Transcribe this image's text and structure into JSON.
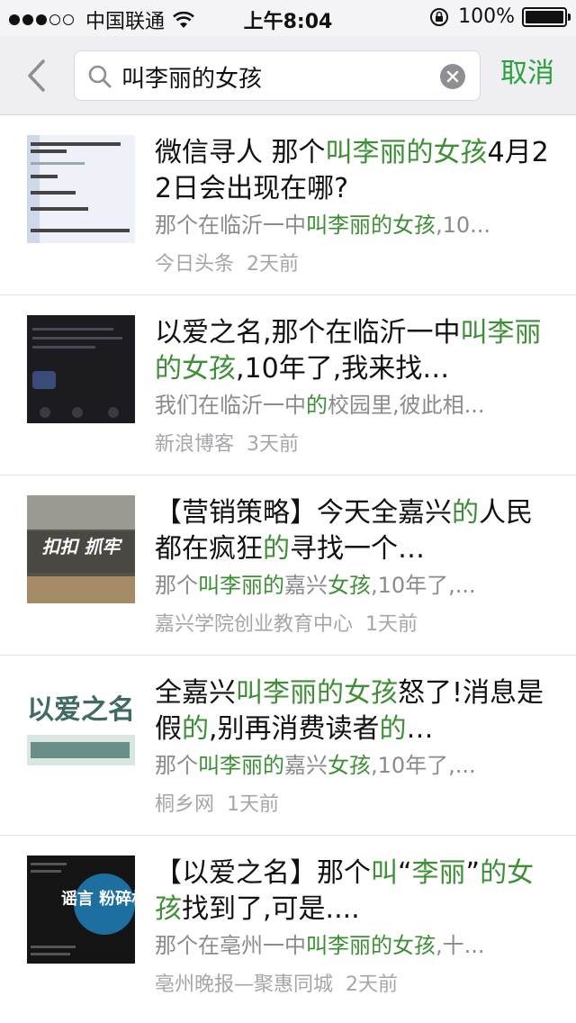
{
  "status_bar": {
    "carrier": "中国联通",
    "time": "上午8:04",
    "battery": "100%",
    "signal_full": 3,
    "signal_total": 5
  },
  "search": {
    "query": "叫李丽的女孩",
    "cancel_label": "取消",
    "back_icon": "chevron-left-icon",
    "search_icon": "magnifier-icon",
    "clear_icon": "clear-x-icon"
  },
  "colors": {
    "highlight": "#3d8f35",
    "cancel": "#2aa13a",
    "title": "#111111",
    "summary": "#8a8a8f",
    "meta": "#a6a6aa"
  },
  "results": [
    {
      "title_parts": [
        {
          "text": "微信寻人 那个",
          "hl": false
        },
        {
          "text": "叫李丽的女孩",
          "hl": true
        },
        {
          "text": "4月22日会出现在哪?",
          "hl": false
        }
      ],
      "summary_parts": [
        {
          "text": "那个在临沂一中",
          "hl": false
        },
        {
          "text": "叫李丽的女孩",
          "hl": true
        },
        {
          "text": ",10...",
          "hl": false
        }
      ],
      "source": "今日头条",
      "time": "2天前"
    },
    {
      "title_parts": [
        {
          "text": "以爱之名,那个在临沂一中",
          "hl": false
        },
        {
          "text": "叫李丽的女孩",
          "hl": true
        },
        {
          "text": ",10年了,我来找…",
          "hl": false
        }
      ],
      "summary_parts": [
        {
          "text": "我们在临沂一中",
          "hl": false
        },
        {
          "text": "的",
          "hl": true
        },
        {
          "text": "校园里,彼此相...",
          "hl": false
        }
      ],
      "source": "新浪博客",
      "time": "3天前"
    },
    {
      "title_parts": [
        {
          "text": "【营销策略】今天全嘉兴",
          "hl": false
        },
        {
          "text": "的",
          "hl": true
        },
        {
          "text": "人民都在疯狂",
          "hl": false
        },
        {
          "text": "的",
          "hl": true
        },
        {
          "text": "寻找一个…",
          "hl": false
        }
      ],
      "summary_parts": [
        {
          "text": "那个",
          "hl": false
        },
        {
          "text": "叫李丽的",
          "hl": true
        },
        {
          "text": "嘉兴",
          "hl": false
        },
        {
          "text": "女孩",
          "hl": true
        },
        {
          "text": ",10年了,...",
          "hl": false
        }
      ],
      "source": "嘉兴学院创业教育中心",
      "time": "1天前",
      "thumb_text": "扣扣 抓牢"
    },
    {
      "title_parts": [
        {
          "text": "全嘉兴",
          "hl": false
        },
        {
          "text": "叫李丽的女孩",
          "hl": true
        },
        {
          "text": "怒了!消息是假",
          "hl": false
        },
        {
          "text": "的",
          "hl": true
        },
        {
          "text": ",别再消费读者",
          "hl": false
        },
        {
          "text": "的",
          "hl": true
        },
        {
          "text": "…",
          "hl": false
        }
      ],
      "summary_parts": [
        {
          "text": "那个",
          "hl": false
        },
        {
          "text": "叫李丽的",
          "hl": true
        },
        {
          "text": "嘉兴",
          "hl": false
        },
        {
          "text": "女孩",
          "hl": true
        },
        {
          "text": ",10年了,...",
          "hl": false
        }
      ],
      "source": "桐乡网",
      "time": "1天前",
      "thumb_text": "以爱之名"
    },
    {
      "title_parts": [
        {
          "text": "【以爱之名】那个",
          "hl": false
        },
        {
          "text": "叫",
          "hl": true
        },
        {
          "text": "“",
          "hl": false
        },
        {
          "text": "李丽",
          "hl": true
        },
        {
          "text": "”",
          "hl": false
        },
        {
          "text": "的女孩",
          "hl": true
        },
        {
          "text": "找到了,可是....",
          "hl": false
        }
      ],
      "summary_parts": [
        {
          "text": "那个在亳州一中",
          "hl": false
        },
        {
          "text": "叫李丽的女孩",
          "hl": true
        },
        {
          "text": ",十...",
          "hl": false
        }
      ],
      "source": "亳州晚报—聚惠同城",
      "time": "2天前",
      "thumb_text": "谣言 粉碎机"
    }
  ]
}
